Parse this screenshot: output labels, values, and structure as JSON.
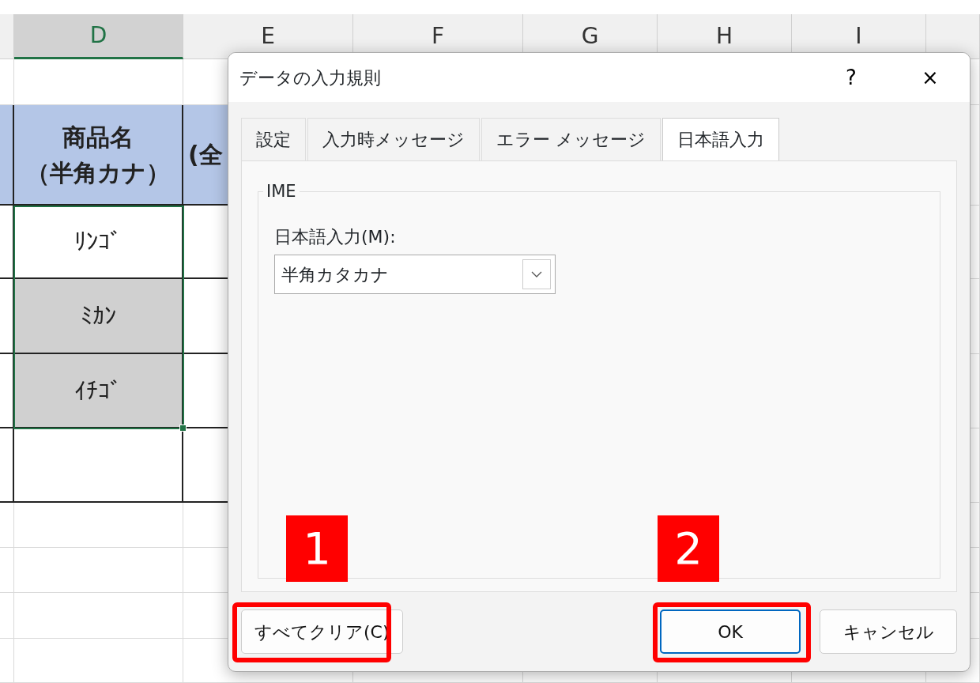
{
  "sheet": {
    "columns": [
      {
        "label": "D",
        "selected": true
      },
      {
        "label": "E",
        "selected": false
      },
      {
        "label": "F",
        "selected": false
      },
      {
        "label": "G",
        "selected": false
      },
      {
        "label": "H",
        "selected": false
      },
      {
        "label": "I",
        "selected": false
      }
    ],
    "header": {
      "lines": [
        "商品名",
        "（半角カナ）"
      ],
      "next": "(全"
    },
    "items": [
      {
        "value": "ﾘﾝｺﾞ",
        "highlighted": false
      },
      {
        "value": "ﾐｶﾝ",
        "highlighted": true
      },
      {
        "value": "ｲﾁｺﾞ",
        "highlighted": true
      }
    ]
  },
  "dialog": {
    "title": "データの入力規則",
    "help": "?",
    "close": "×",
    "tabs": [
      {
        "label": "設定",
        "selected": false
      },
      {
        "label": "入力時メッセージ",
        "selected": false
      },
      {
        "label": "エラー メッセージ",
        "selected": false
      },
      {
        "label": "日本語入力",
        "selected": true
      }
    ],
    "group": "IME",
    "field_label": "日本語入力(M):",
    "select_value": "半角カタカナ",
    "clear_button": "すべてクリア(C)",
    "ok_button": "OK",
    "cancel_button": "キャンセル"
  },
  "annotations": [
    {
      "number": "1"
    },
    {
      "number": "2"
    }
  ]
}
